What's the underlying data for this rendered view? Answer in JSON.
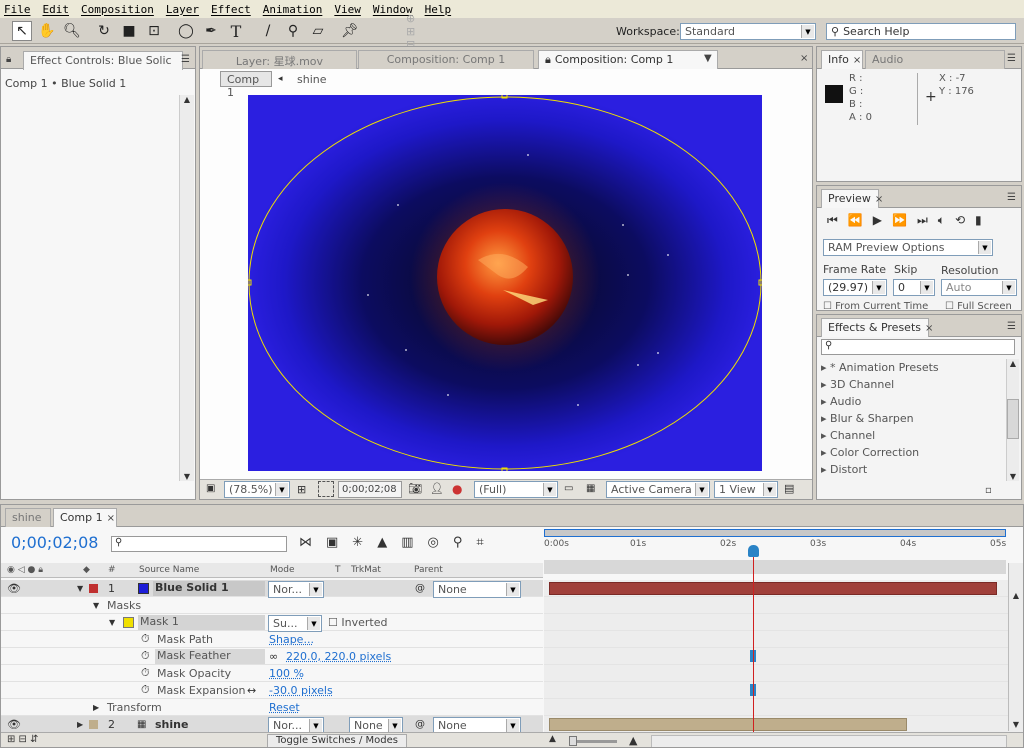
{
  "menu": [
    "File",
    "Edit",
    "Composition",
    "Layer",
    "Effect",
    "Animation",
    "View",
    "Window",
    "Help"
  ],
  "workspace": {
    "label": "Workspace:",
    "value": "Standard"
  },
  "search_help": "Search Help",
  "effect_controls": {
    "tab": "Effect Controls: Blue Solic",
    "breadcrumb": "Comp 1 • Blue Solid 1"
  },
  "viewer": {
    "tab_layer": "Layer: 星球.mov",
    "tab_comp_inactive": "Composition: Comp 1",
    "tab_comp_active": "Composition: Comp 1",
    "crumb_comp": "Comp 1",
    "crumb_layer": "shine",
    "zoom": "(78.5%)",
    "timecode": "0;00;02;08",
    "quality": "(Full)",
    "camera": "Active Camera",
    "views": "1 View"
  },
  "info": {
    "tab_info": "Info",
    "tab_audio": "Audio",
    "r": "R :",
    "g": "G :",
    "b": "B :",
    "a": "A : 0",
    "x": "X : -7",
    "y": "Y : 176"
  },
  "preview": {
    "tab": "Preview",
    "ram_options": "RAM Preview Options",
    "frame_rate_label": "Frame Rate",
    "skip_label": "Skip",
    "resolution_label": "Resolution",
    "frame_rate": "(29.97)",
    "skip": "0",
    "resolution": "Auto",
    "from_current": "From Current Time",
    "full_screen": "Full Screen"
  },
  "effects_presets": {
    "tab": "Effects & Presets",
    "items": [
      "* Animation Presets",
      "3D Channel",
      "Audio",
      "Blur & Sharpen",
      "Channel",
      "Color Correction",
      "Distort"
    ]
  },
  "timeline": {
    "tab_shine": "shine",
    "tab_comp": "Comp 1",
    "timecode": "0;00;02;08",
    "headers": {
      "num": "#",
      "source": "Source Name",
      "mode": "Mode",
      "t": "T",
      "trkmat": "TrkMat",
      "parent": "Parent"
    },
    "ruler": [
      "0:00s",
      "01s",
      "02s",
      "03s",
      "04s",
      "05s"
    ],
    "layer1": {
      "num": "1",
      "name": "Blue Solid 1",
      "mode": "Nor...",
      "parent": "None"
    },
    "masks": "Masks",
    "mask1": {
      "name": "Mask 1",
      "mode": "Su...",
      "inverted": "Inverted"
    },
    "props": [
      {
        "name": "Mask Path",
        "value": "Shape..."
      },
      {
        "name": "Mask Feather",
        "value": "220.0, 220.0 pixels"
      },
      {
        "name": "Mask Opacity",
        "value": "100 %"
      },
      {
        "name": "Mask Expansion",
        "value": "-30.0 pixels"
      }
    ],
    "transform": "Transform",
    "reset": "Reset",
    "layer2": {
      "num": "2",
      "name": "shine",
      "mode": "Nor...",
      "trkmat": "None",
      "parent": "None"
    },
    "toggle": "Toggle Switches / Modes"
  },
  "colors": {
    "layer1_label": "#c03030",
    "solid_swatch": "#1c1cd8",
    "mask_yellow": "#f0e000",
    "layer2_label": "#bfae8c",
    "current_time": "#d02020"
  }
}
